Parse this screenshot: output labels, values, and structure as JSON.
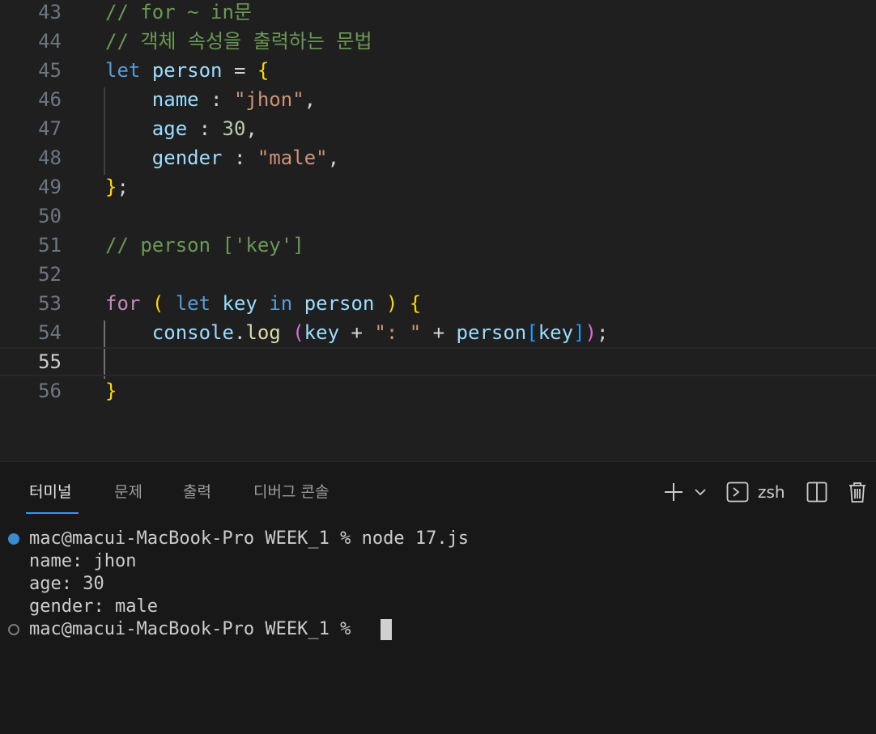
{
  "editor": {
    "lines": [
      {
        "num": "43",
        "tokens": [
          {
            "t": "// for ~ in문",
            "c": "c-comment"
          }
        ]
      },
      {
        "num": "44",
        "tokens": [
          {
            "t": "// 객체 속성을 출력하는 문법",
            "c": "c-comment"
          }
        ]
      },
      {
        "num": "45",
        "tokens": [
          {
            "t": "let",
            "c": "c-kw"
          },
          {
            "t": " "
          },
          {
            "t": "person",
            "c": "c-var"
          },
          {
            "t": " = ",
            "c": "c-op"
          },
          {
            "t": "{",
            "c": "c-b1"
          }
        ]
      },
      {
        "num": "46",
        "tokens": [
          {
            "t": "    "
          },
          {
            "t": "name",
            "c": "c-var"
          },
          {
            "t": " : ",
            "c": "c-op"
          },
          {
            "t": "\"jhon\"",
            "c": "c-str"
          },
          {
            "t": ",",
            "c": "c-op"
          }
        ]
      },
      {
        "num": "47",
        "tokens": [
          {
            "t": "    "
          },
          {
            "t": "age",
            "c": "c-var"
          },
          {
            "t": " : ",
            "c": "c-op"
          },
          {
            "t": "30",
            "c": "c-num"
          },
          {
            "t": ",",
            "c": "c-op"
          }
        ]
      },
      {
        "num": "48",
        "tokens": [
          {
            "t": "    "
          },
          {
            "t": "gender",
            "c": "c-var"
          },
          {
            "t": " : ",
            "c": "c-op"
          },
          {
            "t": "\"male\"",
            "c": "c-str"
          },
          {
            "t": ",",
            "c": "c-op"
          }
        ]
      },
      {
        "num": "49",
        "tokens": [
          {
            "t": "}",
            "c": "c-b1"
          },
          {
            "t": ";",
            "c": "c-op"
          }
        ]
      },
      {
        "num": "50",
        "tokens": []
      },
      {
        "num": "51",
        "tokens": [
          {
            "t": "// person ['key']",
            "c": "c-comment"
          }
        ]
      },
      {
        "num": "52",
        "tokens": []
      },
      {
        "num": "53",
        "tokens": [
          {
            "t": "for",
            "c": "c-ctrl"
          },
          {
            "t": " "
          },
          {
            "t": "(",
            "c": "c-b1"
          },
          {
            "t": " "
          },
          {
            "t": "let",
            "c": "c-kw"
          },
          {
            "t": " "
          },
          {
            "t": "key",
            "c": "c-var"
          },
          {
            "t": " "
          },
          {
            "t": "in",
            "c": "c-kw"
          },
          {
            "t": " "
          },
          {
            "t": "person",
            "c": "c-var"
          },
          {
            "t": " "
          },
          {
            "t": ")",
            "c": "c-b1"
          },
          {
            "t": " "
          },
          {
            "t": "{",
            "c": "c-b1"
          }
        ]
      },
      {
        "num": "54",
        "tokens": [
          {
            "t": "    "
          },
          {
            "t": "console",
            "c": "c-var"
          },
          {
            "t": ".",
            "c": "c-op"
          },
          {
            "t": "log",
            "c": "c-fn"
          },
          {
            "t": " "
          },
          {
            "t": "(",
            "c": "c-b2"
          },
          {
            "t": "key",
            "c": "c-var"
          },
          {
            "t": " + ",
            "c": "c-op"
          },
          {
            "t": "\": \"",
            "c": "c-str"
          },
          {
            "t": " + ",
            "c": "c-op"
          },
          {
            "t": "person",
            "c": "c-var"
          },
          {
            "t": "[",
            "c": "c-b3"
          },
          {
            "t": "key",
            "c": "c-var"
          },
          {
            "t": "]",
            "c": "c-b3"
          },
          {
            "t": ")",
            "c": "c-b2"
          },
          {
            "t": ";",
            "c": "c-op"
          }
        ]
      },
      {
        "num": "55",
        "tokens": [],
        "current": true
      },
      {
        "num": "56",
        "tokens": [
          {
            "t": "}",
            "c": "c-b1"
          }
        ]
      }
    ]
  },
  "panel": {
    "tabs": [
      {
        "label": "터미널",
        "active": true
      },
      {
        "label": "문제",
        "active": false
      },
      {
        "label": "출력",
        "active": false
      },
      {
        "label": "디버그 콘솔",
        "active": false
      }
    ],
    "toolbar": {
      "new_terminal_icon": "plus-icon",
      "dropdown_icon": "chevron-down-icon",
      "shell_icon": "terminal-icon",
      "shell_label": "zsh",
      "split_icon": "split-icon",
      "kill_icon": "trash-icon"
    }
  },
  "terminal": {
    "lines": [
      {
        "text": "mac@macui-MacBook-Pro WEEK_1 % node 17.js",
        "marker": "success"
      },
      {
        "text": "name: jhon",
        "marker": "none"
      },
      {
        "text": "age: 30",
        "marker": "none"
      },
      {
        "text": "gender: male",
        "marker": "none"
      },
      {
        "text": "mac@macui-MacBook-Pro WEEK_1 % ",
        "marker": "empty"
      }
    ]
  },
  "colors": {
    "accent": "#3794ff",
    "success_dot": "#3a8bd1"
  }
}
